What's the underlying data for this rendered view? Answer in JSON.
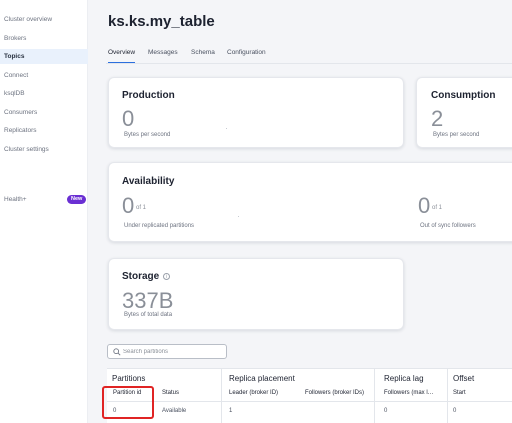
{
  "sidebar": {
    "items": [
      {
        "label": "Cluster overview",
        "active": false
      },
      {
        "label": "Brokers",
        "active": false
      },
      {
        "label": "Topics",
        "active": true
      },
      {
        "label": "Connect",
        "active": false
      },
      {
        "label": "ksqlDB",
        "active": false
      },
      {
        "label": "Consumers",
        "active": false
      },
      {
        "label": "Replicators",
        "active": false
      },
      {
        "label": "Cluster settings",
        "active": false
      }
    ],
    "health_label": "Health+",
    "new_badge": "New"
  },
  "page": {
    "title": "ks.ks.my_table",
    "tabs": [
      "Overview",
      "Messages",
      "Schema",
      "Configuration"
    ],
    "active_tab": "Overview"
  },
  "production": {
    "title": "Production",
    "value": "0",
    "unit": "Bytes per second"
  },
  "consumption": {
    "title": "Consumption",
    "value": "2",
    "unit": "Bytes per second"
  },
  "availability": {
    "title": "Availability",
    "under_replicated": {
      "value": "0",
      "of": "of 1",
      "label": "Under replicated partitions"
    },
    "out_of_sync": {
      "value": "0",
      "of": "of 1",
      "label": "Out of sync followers"
    }
  },
  "storage": {
    "title": "Storage",
    "value": "337B",
    "unit": "Bytes of total data"
  },
  "search": {
    "placeholder": "Search partitions",
    "value": ""
  },
  "table": {
    "groups": {
      "partitions": "Partitions",
      "replica_placement": "Replica placement",
      "replica_lag": "Replica lag",
      "offset": "Offset"
    },
    "columns": {
      "partition_id": "Partition id",
      "status": "Status",
      "leader": "Leader (broker ID)",
      "followers": "Followers (broker IDs)",
      "followers_lag": "Followers (max l…",
      "start": "Start"
    },
    "rows": [
      {
        "partition_id": "0",
        "status": "Available",
        "leader": "1",
        "followers": "",
        "followers_lag": "0",
        "start": "0"
      }
    ]
  },
  "colors": {
    "accent": "#2b6fde",
    "badge": "#6a2fd3",
    "highlight": "#e02424"
  }
}
